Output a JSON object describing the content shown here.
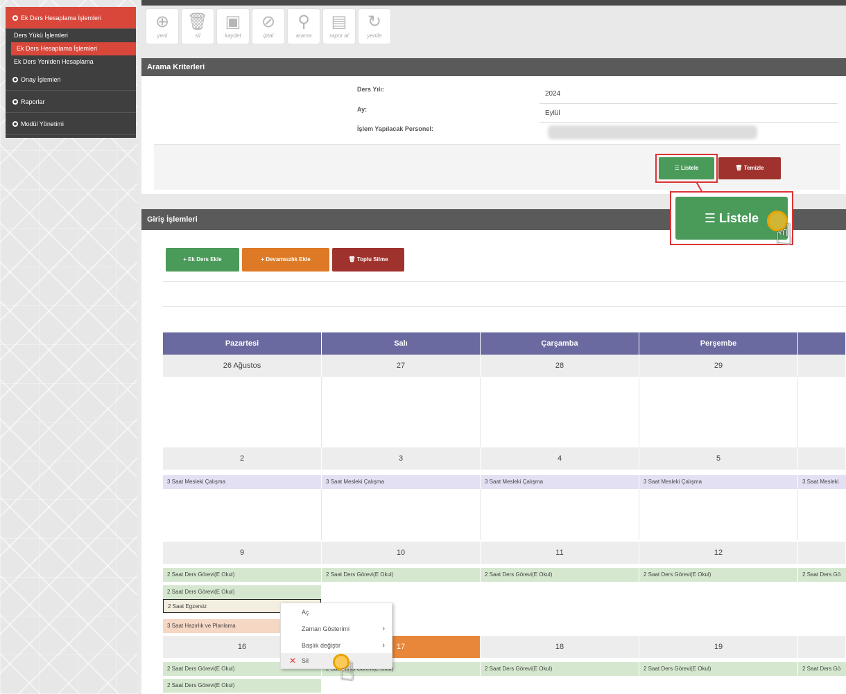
{
  "sidebar": {
    "menu": [
      {
        "label": "Ek Ders Hesaplama İşlemleri",
        "active": true
      },
      {
        "label": "Onay İşlemleri",
        "active": false
      },
      {
        "label": "Raporlar",
        "active": false
      },
      {
        "label": "Modül Yönetimi",
        "active": false
      }
    ],
    "subitems": [
      {
        "label": "Ders Yükü İşlemleri",
        "active": false
      },
      {
        "label": "Ek Ders Hesaplama İşlemleri",
        "active": true
      },
      {
        "label": "Ek Ders Yeniden Hesaplama",
        "active": false
      }
    ]
  },
  "toolbar": {
    "buttons": [
      {
        "label": "yeni",
        "icon": "plus-circle-icon"
      },
      {
        "label": "sil",
        "icon": "trash-icon"
      },
      {
        "label": "kaydet",
        "icon": "save-icon"
      },
      {
        "label": "iptal",
        "icon": "cancel-icon"
      },
      {
        "label": "arama",
        "icon": "search-icon"
      },
      {
        "label": "rapor al",
        "icon": "report-icon"
      },
      {
        "label": "yenile",
        "icon": "refresh-icon"
      }
    ]
  },
  "criteria": {
    "title": "Arama Kriterleri",
    "year_label": "Ders Yılı:",
    "year_value": "2024",
    "month_label": "Ay:",
    "month_value": "Eylül",
    "personel_label": "İşlem Yapılacak Personel:",
    "list_button": "Listele",
    "clear_button": "Temizle",
    "zoom_list_button": "Listele"
  },
  "entries": {
    "title": "Giriş İşlemleri",
    "add_lesson_button": "Ek Ders Ekle",
    "add_attendance_button": "Devamsızlık Ekle",
    "bulk_delete_button": "Toplu Silme"
  },
  "calendar": {
    "days": [
      "Pazartesi",
      "Salı",
      "Çarşamba",
      "Perşembe"
    ],
    "week1": [
      "26 Ağustos",
      "27",
      "28",
      "29"
    ],
    "week2": [
      "2",
      "3",
      "4",
      "5"
    ],
    "week2_events": [
      "3 Saat Mesleki Çalışma",
      "3 Saat Mesleki Çalışma",
      "3 Saat Mesleki Çalışma",
      "3 Saat Mesleki Çalışma",
      "3 Saat Mesleki"
    ],
    "week3": [
      "9",
      "10",
      "11",
      "12"
    ],
    "week3_events": [
      "2 Saat Ders Görevi(E Okul)",
      "2 Saat Ders Görevi(E Okul)",
      "2 Saat Ders Görevi(E Okul)",
      "2 Saat Ders Görevi(E Okul)",
      "2 Saat Ders Gö"
    ],
    "week3_mon_extra": [
      "2 Saat Ders Görevi(E Okul)",
      "2 Saat Egzersiz",
      "3 Saat Hazırlık ve Planlama"
    ],
    "week4": [
      "16",
      "17",
      "18",
      "19"
    ],
    "week4_events": [
      "2 Saat Ders Görevi(E Okul)",
      "2 Saat Ders Görevi(E Okul)",
      "2 Saat Ders Görevi(E Okul)",
      "2 Saat Ders Görevi(E Okul)",
      "2 Saat Ders Gö"
    ],
    "week4_mon_extra": "2 Saat Ders Görevi(E Okul)"
  },
  "context_menu": {
    "items": [
      "Aç",
      "Zaman Gösterimi",
      "Başlık değiştir",
      "Sil"
    ]
  },
  "colors": {
    "accent_red": "#d9473b",
    "header_purple": "#6a6aa0",
    "button_green": "#4a9a5a",
    "highlight_orange": "#e8873a"
  }
}
